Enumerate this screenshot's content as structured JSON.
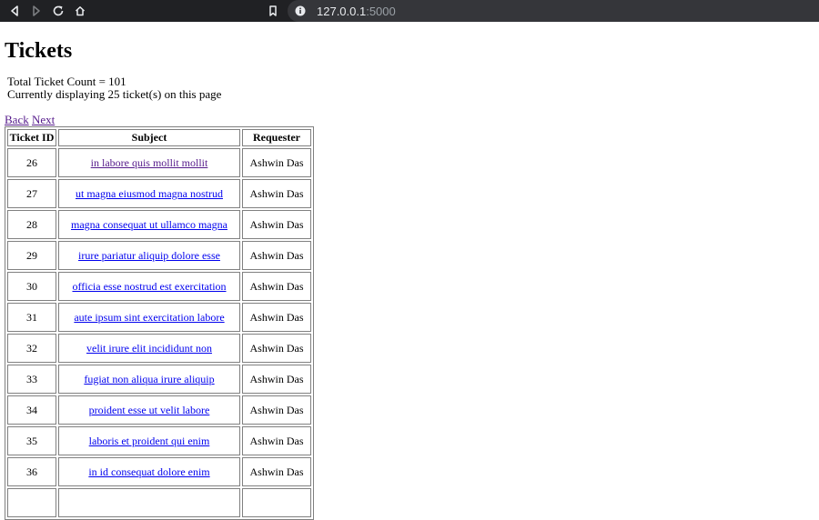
{
  "browser": {
    "url_host": "127.0.0.1",
    "url_port": ":5000"
  },
  "page": {
    "title": "Tickets",
    "total_count_text": "Total Ticket Count = 101",
    "display_count_text": "Currently displaying 25 ticket(s) on this page",
    "back_label": "Back",
    "next_label": "Next"
  },
  "table": {
    "headers": {
      "id": "Ticket ID",
      "subject": "Subject",
      "requester": "Requester"
    },
    "rows": [
      {
        "id": "26",
        "subject": "in labore quis mollit mollit",
        "requester": "Ashwin Das",
        "visited": true
      },
      {
        "id": "27",
        "subject": "ut magna eiusmod magna nostrud",
        "requester": "Ashwin Das",
        "visited": false
      },
      {
        "id": "28",
        "subject": "magna consequat ut ullamco magna",
        "requester": "Ashwin Das",
        "visited": false
      },
      {
        "id": "29",
        "subject": "irure pariatur aliquip dolore esse",
        "requester": "Ashwin Das",
        "visited": false
      },
      {
        "id": "30",
        "subject": "officia esse nostrud est exercitation",
        "requester": "Ashwin Das",
        "visited": false
      },
      {
        "id": "31",
        "subject": "aute ipsum sint exercitation labore",
        "requester": "Ashwin Das",
        "visited": false
      },
      {
        "id": "32",
        "subject": "velit irure elit incididunt non",
        "requester": "Ashwin Das",
        "visited": false
      },
      {
        "id": "33",
        "subject": "fugiat non aliqua irure aliquip",
        "requester": "Ashwin Das",
        "visited": false
      },
      {
        "id": "34",
        "subject": "proident esse ut velit labore",
        "requester": "Ashwin Das",
        "visited": false
      },
      {
        "id": "35",
        "subject": "laboris et proident qui enim",
        "requester": "Ashwin Das",
        "visited": false
      },
      {
        "id": "36",
        "subject": "in id consequat dolore enim",
        "requester": "Ashwin Das",
        "visited": false
      },
      {
        "id": "",
        "subject": "",
        "requester": "",
        "visited": false
      }
    ]
  },
  "colors": {
    "link": "#0000ee",
    "visited_link": "#551a8b",
    "chrome_bg": "#202124",
    "address_bar_bg": "#35363a"
  }
}
